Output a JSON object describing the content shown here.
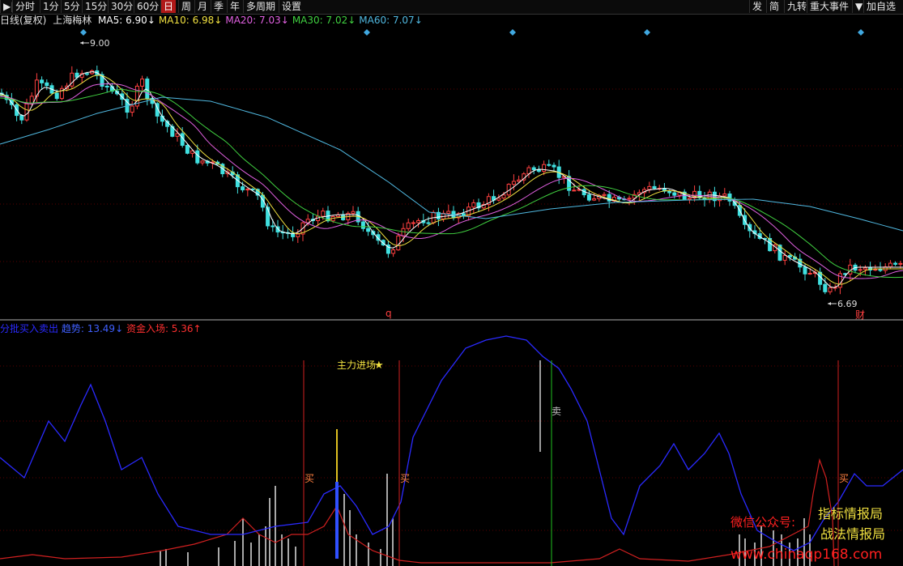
{
  "toolbar": {
    "left": [
      {
        "id": "play",
        "label": "▶|"
      },
      {
        "id": "fenshi",
        "label": "分时"
      },
      {
        "id": "1m",
        "label": "1分"
      },
      {
        "id": "5m",
        "label": "5分"
      },
      {
        "id": "15m",
        "label": "15分"
      },
      {
        "id": "30m",
        "label": "30分"
      },
      {
        "id": "60m",
        "label": "60分"
      },
      {
        "id": "day",
        "label": "日",
        "active": true
      },
      {
        "id": "week",
        "label": "周"
      },
      {
        "id": "month",
        "label": "月"
      },
      {
        "id": "season",
        "label": "季"
      },
      {
        "id": "year",
        "label": "年"
      },
      {
        "id": "multi",
        "label": "多周期"
      },
      {
        "id": "settings",
        "label": "设置"
      }
    ],
    "right": [
      {
        "id": "fa",
        "label": "发"
      },
      {
        "id": "jian",
        "label": "简"
      },
      {
        "id": "jiuzhuan",
        "label": "九转"
      },
      {
        "id": "events",
        "label": "重大事件"
      },
      {
        "id": "dropdown",
        "label": "▼"
      },
      {
        "id": "addfav",
        "label": "加自选"
      }
    ]
  },
  "main_chart": {
    "period_label": "日线(复权)",
    "stock_name": "上海梅林",
    "ma": [
      {
        "label": "MA5: 6.90",
        "arrow": "↓",
        "color": "#ffffff"
      },
      {
        "label": "MA10: 6.98",
        "arrow": "↓",
        "color": "#f0e040"
      },
      {
        "label": "MA20: 7.03",
        "arrow": "↓",
        "color": "#e060e0"
      },
      {
        "label": "MA30: 7.02",
        "arrow": "↓",
        "color": "#40d040"
      },
      {
        "label": "MA60: 7.07",
        "arrow": "↓",
        "color": "#50b8e0"
      }
    ],
    "high_label": "9.00",
    "low_label": "6.69",
    "q_marker": "q",
    "cai_marker": "财"
  },
  "indicator": {
    "name": "分批买入卖出",
    "trend_label": "趋势: 13.49",
    "trend_arrow": "↓",
    "fund_label": "资金入场: 5.36",
    "fund_arrow": "↑",
    "main_force_label": "主力进场",
    "star": "★",
    "buy_label": "买",
    "sell_label": "卖"
  },
  "watermark": {
    "line1_a": "微信公众号:",
    "line1_b": "指标情报局",
    "line2": "战法情报局",
    "url": "www.chinaqp168.com"
  },
  "colors": {
    "up": "#ff4040",
    "down": "#40e0e0",
    "ma5": "#ffffff",
    "ma10": "#f0e040",
    "ma20": "#e060e0",
    "ma30": "#40d040",
    "ma60": "#50b8e0",
    "trend": "#2a2aff",
    "fund": "#d02020"
  }
}
